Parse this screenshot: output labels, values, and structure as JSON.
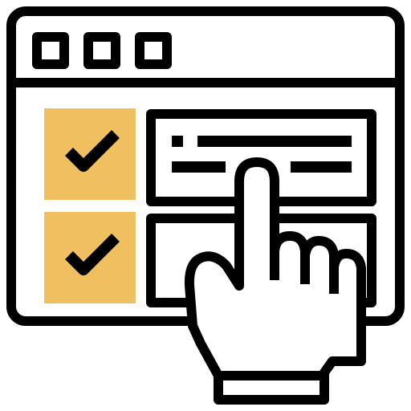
{
  "colors": {
    "outline": "#000000",
    "background": "#ffffff",
    "accent": "#f0bf5f"
  },
  "icons": [
    "browser-window-icon",
    "window-control-icon",
    "check-icon",
    "tap-hand-icon",
    "text-line-icon"
  ]
}
